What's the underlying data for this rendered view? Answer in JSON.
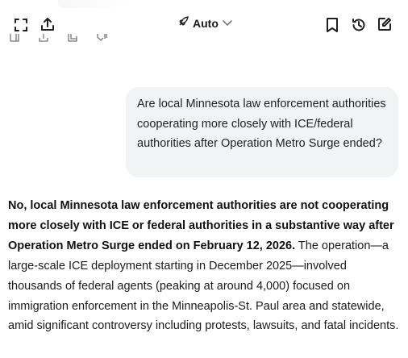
{
  "header": {
    "mode_label": "Auto",
    "icons": {
      "expand": "expand-icon",
      "share": "share-icon",
      "mode": "rocket-icon",
      "chevron": "chevron-down-icon",
      "bookmark": "bookmark-icon",
      "history": "history-icon",
      "edit": "compose-icon"
    }
  },
  "conversation": {
    "user_message": "Are local Minnesota law enforcement authorities cooperating more closely with ICE/federal authorities after Operation Metro Surge ended?",
    "response": {
      "bold_lead": "No, local Minnesota law enforcement authorities are not cooperating more closely with ICE or federal authorities in a substantive way after Operation Metro Surge ended on February 12, 2026.",
      "body": " The operation—a large-scale ICE deployment starting in December 2025—involved thousands of federal agents (peaking at around 4,000) focused on immigration enforcement in the Minneapolis-St. Paul area and statewide, amid significant controversy including protests, lawsuits, and fatal incidents."
    }
  },
  "colors": {
    "bubble_bg": "#f1f4f5",
    "text": "#1a1a1a",
    "icon": "#1f1f1f"
  }
}
